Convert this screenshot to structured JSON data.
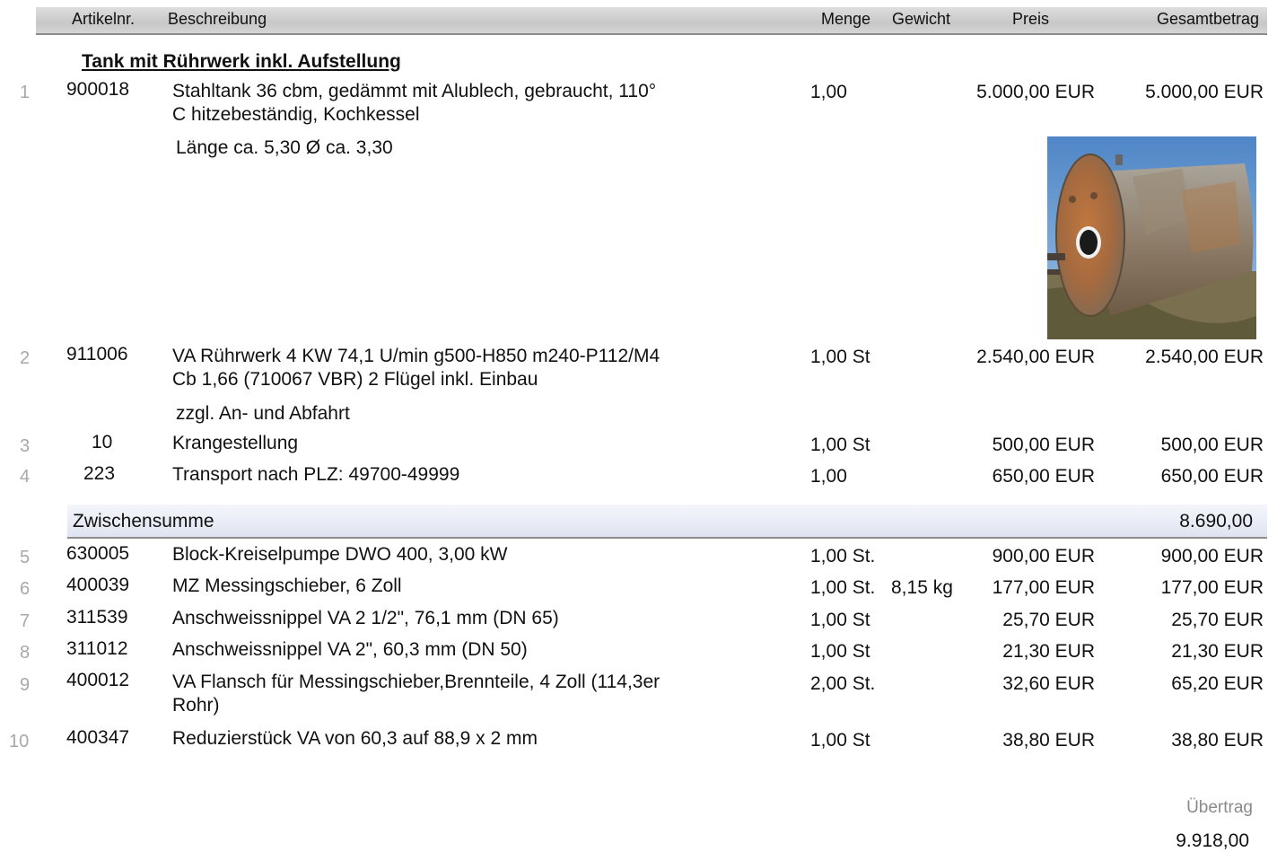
{
  "header": {
    "col_artikelnr": "Artikelnr.",
    "col_beschreibung": "Beschreibung",
    "col_menge": "Menge",
    "col_gewicht": "Gewicht",
    "col_preis": "Preis",
    "col_gesamt": "Gesamtbetrag"
  },
  "section_title": "Tank mit Rührwerk inkl. Aufstellung",
  "items": [
    {
      "no": "1",
      "art": "900018",
      "desc1": "Stahltank 36 cbm, gedämmt mit Alublech, gebraucht, 110°",
      "desc2": "C hitzebeständig, Kochkessel",
      "note": "Länge ca. 5,30 Ø ca. 3,30",
      "menge": "1,00",
      "gewicht": "",
      "preis": "5.000,00 EUR",
      "gesamt": "5.000,00 EUR"
    },
    {
      "no": "2",
      "art": "911006",
      "desc1": "VA Rührwerk 4 KW 74,1 U/min g500-H850 m240-P112/M4",
      "desc2": "Cb 1,66 (710067 VBR) 2 Flügel inkl. Einbau",
      "note": "zzgl. An- und Abfahrt",
      "menge": "1,00 St",
      "gewicht": "",
      "preis": "2.540,00 EUR",
      "gesamt": "2.540,00 EUR"
    },
    {
      "no": "3",
      "art": "10",
      "desc1": "Krangestellung",
      "menge": "1,00 St",
      "gewicht": "",
      "preis": "500,00 EUR",
      "gesamt": "500,00 EUR"
    },
    {
      "no": "4",
      "art": "223",
      "desc1": "Transport nach PLZ: 49700-49999",
      "menge": "1,00",
      "gewicht": "",
      "preis": "650,00 EUR",
      "gesamt": "650,00 EUR"
    },
    {
      "no": "5",
      "art": "630005",
      "desc1": "Block-Kreiselpumpe DWO 400, 3,00 kW",
      "menge": "1,00 St.",
      "gewicht": "",
      "preis": "900,00 EUR",
      "gesamt": "900,00 EUR"
    },
    {
      "no": "6",
      "art": "400039",
      "desc1": "MZ Messingschieber, 6 Zoll",
      "menge": "1,00 St.",
      "gewicht": "8,15 kg",
      "preis": "177,00 EUR",
      "gesamt": "177,00 EUR"
    },
    {
      "no": "7",
      "art": "311539",
      "desc1": "Anschweissnippel VA 2 1/2\", 76,1 mm (DN 65)",
      "menge": "1,00 St",
      "gewicht": "",
      "preis": "25,70 EUR",
      "gesamt": "25,70 EUR"
    },
    {
      "no": "8",
      "art": "311012",
      "desc1": "Anschweissnippel VA 2\", 60,3 mm (DN 50)",
      "menge": "1,00 St",
      "gewicht": "",
      "preis": "21,30 EUR",
      "gesamt": "21,30 EUR"
    },
    {
      "no": "9",
      "art": "400012",
      "desc1": "VA Flansch für Messingschieber,Brennteile, 4 Zoll (114,3er",
      "desc2": "Rohr)",
      "menge": "2,00 St.",
      "gewicht": "",
      "preis": "32,60 EUR",
      "gesamt": "65,20 EUR"
    },
    {
      "no": "10",
      "art": "400347",
      "desc1": "Reduzierstück VA von 60,3 auf 88,9 x 2 mm",
      "menge": "1,00 St",
      "gewicht": "",
      "preis": "38,80 EUR",
      "gesamt": "38,80 EUR"
    }
  ],
  "subtotal": {
    "label": "Zwischensumme",
    "value": "8.690,00"
  },
  "footer": {
    "label": "Übertrag",
    "value": "9.918,00"
  }
}
